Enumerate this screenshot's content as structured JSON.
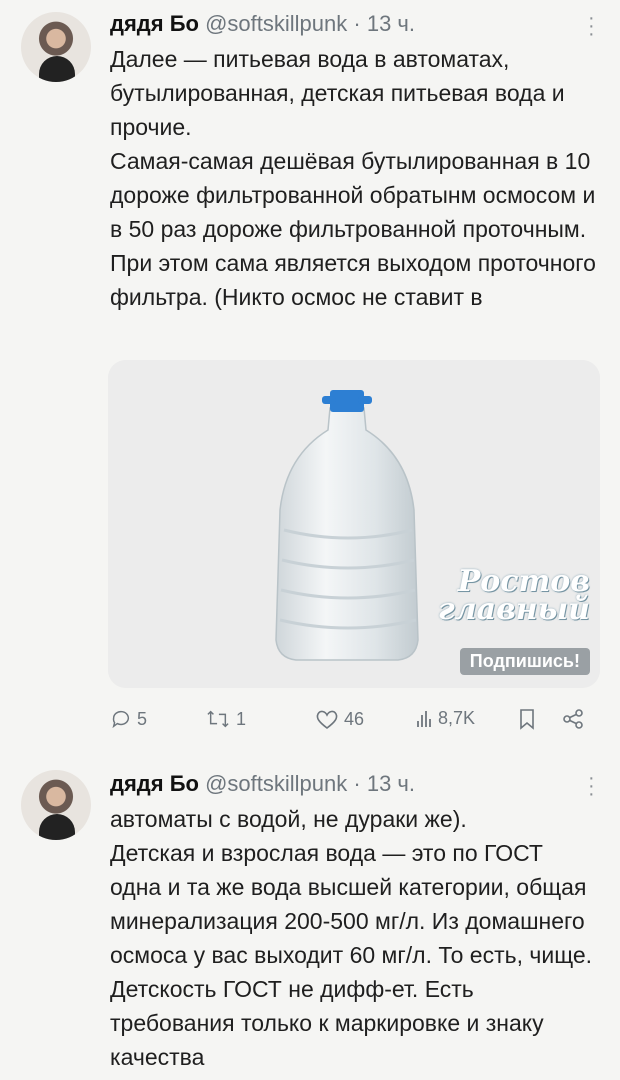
{
  "tweets": [
    {
      "author": {
        "name": "дядя Бо",
        "handle": "@softskillpunk",
        "separator": "·",
        "time": "13 ч."
      },
      "text": [
        "Далее — питьевая вода в автоматах, бутылированная, детская питьевая вода и прочие.",
        "Самая-самая дешёвая бутылированная в 10 дороже фильтрованной обратынм осмосом и в 50 раз дороже фильтрованной проточным. При этом сама является выходом проточного фильтра. (Никто осмос не ставит в"
      ],
      "media": {
        "description_icon": "water-bottle-image",
        "logo_text": [
          "Ростов",
          "главный"
        ],
        "badge": "Подпишись!"
      },
      "stats": {
        "replies": "5",
        "retweets": "1",
        "likes": "46",
        "views": "8,7K"
      }
    },
    {
      "author": {
        "name": "дядя Бо",
        "handle": "@softskillpunk",
        "separator": "·",
        "time": "13 ч."
      },
      "text": [
        "автоматы с водой, не дураки же).",
        "Детская и взрослая вода — это по ГОСТ одна и та же вода высшей категории, общая минерализация 200-500 мг/л. Из домашнего осмоса у вас выходит 60 мг/л. То есть, чище. Детскость ГОСТ не дифф-ет. Есть требования только к маркировке и знаку качества"
      ]
    }
  ],
  "icons": {
    "reply": "reply-icon",
    "retweet": "retweet-icon",
    "like": "like-icon",
    "views": "views-icon",
    "bookmark": "bookmark-icon",
    "share": "share-icon",
    "more": "more-icon"
  },
  "colors": {
    "muted": "#6e767d",
    "bottle_cap": "#2d7fd3",
    "background": "#f5f5f3"
  }
}
